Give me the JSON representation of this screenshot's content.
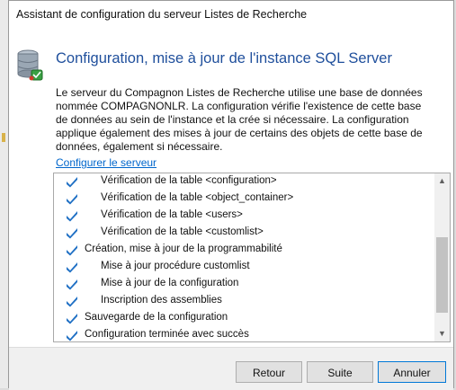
{
  "window": {
    "title": "Assistant de configuration du serveur Listes de Recherche"
  },
  "header": {
    "icon": "database-server-icon",
    "title": "Configuration, mise à jour de l'instance SQL Server"
  },
  "description": "Le serveur du Compagnon Listes de Recherche utilise une base de données nommée COMPAGNONLR. La configuration vérifie l'existence de cette base de données au sein de l'instance et la crée si nécessaire. La configuration applique également des mises à jour de certains des objets de cette base de données, également si nécessaire.",
  "configure_link": "Configurer le serveur",
  "log": {
    "items": [
      {
        "label": "Vérification de la table <configuration>",
        "level": 1
      },
      {
        "label": "Vérification de la table <object_container>",
        "level": 1
      },
      {
        "label": "Vérification de la table <users>",
        "level": 1
      },
      {
        "label": "Vérification de la table <customlist>",
        "level": 1
      },
      {
        "label": "Création, mise à jour de la programmabilité",
        "level": 0
      },
      {
        "label": "Mise à jour procédure customlist",
        "level": 1
      },
      {
        "label": "Mise à jour de la configuration",
        "level": 1
      },
      {
        "label": "Inscription des assemblies",
        "level": 1
      },
      {
        "label": "Sauvegarde de la configuration",
        "level": 0
      },
      {
        "label": "Configuration terminée avec succès",
        "level": 0
      }
    ],
    "item_icon": "checkmark-icon",
    "check_color": "#1e6fc4",
    "scroll_position": 0.78,
    "scroll_visible_fraction": 0.55
  },
  "buttons": {
    "back": "Retour",
    "next": "Suite",
    "cancel": "Annuler"
  }
}
